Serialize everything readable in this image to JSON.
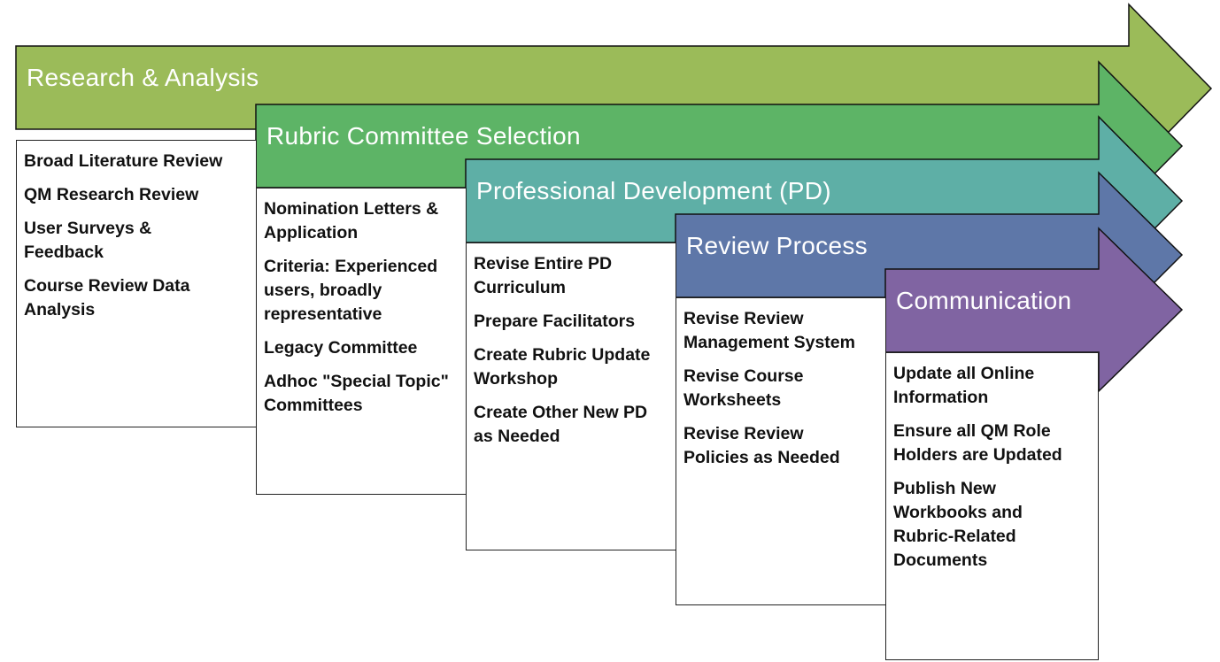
{
  "stages": [
    {
      "title": "Research & Analysis",
      "color": "#9BBB59",
      "items": [
        "Broad Literature Review",
        "QM Research Review",
        "User Surveys & Feedback",
        "Course Review Data Analysis"
      ]
    },
    {
      "title": "Rubric Committee Selection",
      "color": "#5DB466",
      "items": [
        "Nomination Letters & Application",
        "Criteria: Experienced users, broadly representative",
        "Legacy Committee",
        "Adhoc \"Special Topic\" Committees"
      ]
    },
    {
      "title": "Professional Development (PD)",
      "color": "#5EAFA6",
      "items": [
        "Revise Entire PD Curriculum",
        "Prepare Facilitators",
        "Create Rubric Update Workshop",
        "Create Other New PD as Needed"
      ]
    },
    {
      "title": "Review Process",
      "color": "#5E77A8",
      "items": [
        "Revise Review Management System",
        "Revise Course Worksheets",
        "Revise Review Policies as Needed"
      ]
    },
    {
      "title": "Communication",
      "color": "#8064A2",
      "items": [
        "Update all Online Information",
        "Ensure all QM Role Holders are Updated",
        "Publish New Workbooks and Rubric-Related Documents"
      ]
    }
  ]
}
